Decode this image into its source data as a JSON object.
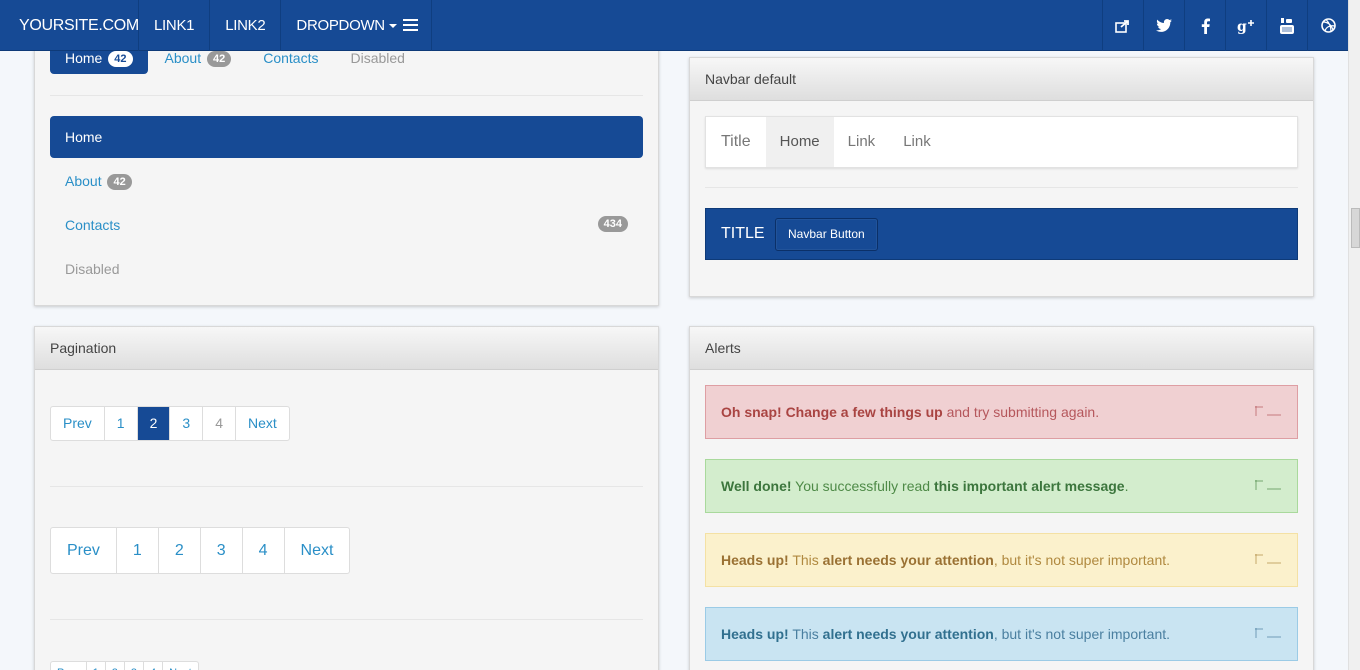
{
  "navbar": {
    "brand": "YOURSITE.COM",
    "links": [
      "LINK1",
      "LINK2",
      "DROPDOWN"
    ],
    "menu_icon": "hamburger-icon",
    "social_icons": [
      "share-icon",
      "twitter-icon",
      "facebook-icon",
      "google-plus-icon",
      "youtube-icon",
      "dribbble-icon"
    ],
    "color": "#164a95"
  },
  "nav_panel": {
    "pills": [
      {
        "label": "Home",
        "badge": "42"
      },
      {
        "label": "About",
        "badge": "42"
      },
      {
        "label": "Contacts"
      },
      {
        "label": "Disabled"
      }
    ],
    "stacked": [
      {
        "label": "Home"
      },
      {
        "label": "About",
        "badge": "42"
      },
      {
        "label": "Contacts",
        "badge": "434"
      },
      {
        "label": "Disabled"
      }
    ]
  },
  "navbar_panel": {
    "title": "Navbar default",
    "default_bar": {
      "title": "Title",
      "links": [
        "Home",
        "Link",
        "Link"
      ]
    },
    "inverse_bar": {
      "title": "TITLE",
      "button": "Navbar Button"
    }
  },
  "pagination_panel": {
    "title": "Pagination",
    "items": [
      "Prev",
      "1",
      "2",
      "3",
      "4",
      "Next"
    ],
    "active_page": "2"
  },
  "alerts_panel": {
    "title": "Alerts",
    "alerts": [
      {
        "type": "danger",
        "strong1": "Oh snap!",
        "strong2": "Change a few things up",
        "text": "and try submitting again."
      },
      {
        "type": "success",
        "strong1": "Well done!",
        "text1": "You successfully read",
        "strong2": "this important alert message",
        "text2": "."
      },
      {
        "type": "warning",
        "strong1": "Heads up!",
        "text1": "This",
        "strong2": "alert needs your attention",
        "text2": ", but it's not super important."
      },
      {
        "type": "info",
        "strong1": "Heads up!",
        "text1": "This",
        "strong2": "alert needs your attention",
        "text2": ", but it's not super important."
      }
    ]
  }
}
